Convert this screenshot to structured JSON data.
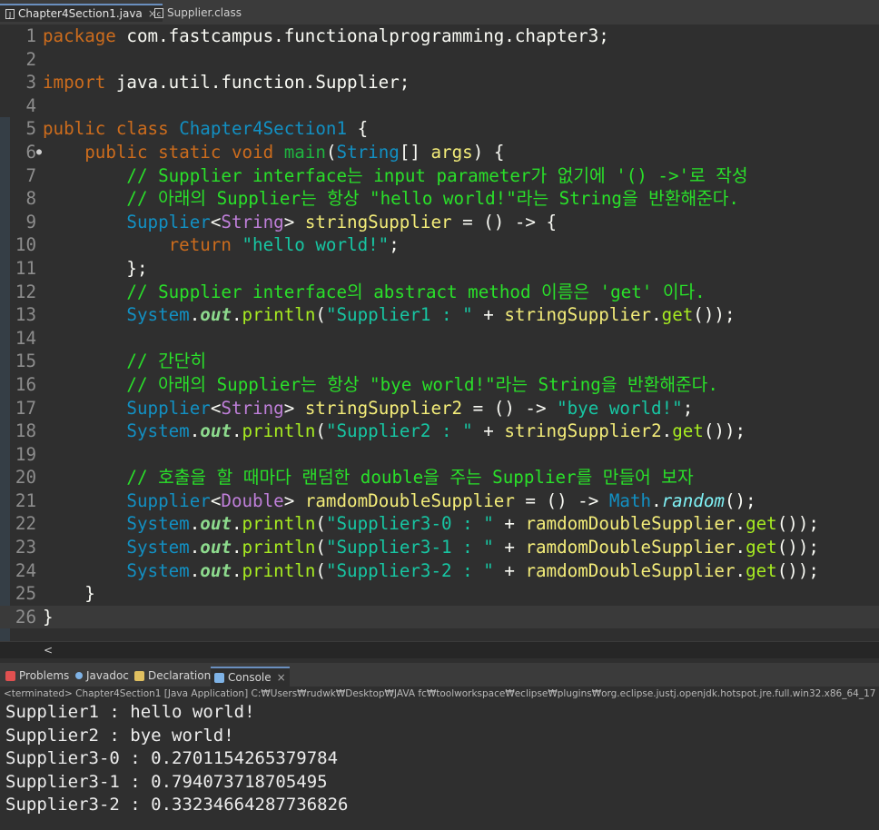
{
  "editor_tabs": [
    {
      "label": "Chapter4Section1.java",
      "close": "×",
      "active": true
    },
    {
      "label": "Supplier.class",
      "active": false
    }
  ],
  "code_lines": [
    {
      "n": "1",
      "tokens": [
        [
          "k",
          "package"
        ],
        [
          "p",
          " com.fastcampus.functionalprogramming.chapter3;"
        ]
      ]
    },
    {
      "n": "2",
      "tokens": []
    },
    {
      "n": "3",
      "tokens": [
        [
          "k",
          "import"
        ],
        [
          "p",
          " java.util.function.Supplier;"
        ]
      ]
    },
    {
      "n": "4",
      "tokens": []
    },
    {
      "n": "5",
      "tokens": [
        [
          "k",
          "public"
        ],
        [
          "p",
          " "
        ],
        [
          "k",
          "class"
        ],
        [
          "p",
          " "
        ],
        [
          "t",
          "Chapter4Section1"
        ],
        [
          "p",
          " {"
        ]
      ]
    },
    {
      "n": "6",
      "overrideMarker": "●",
      "tokens": [
        [
          "p",
          "    "
        ],
        [
          "k",
          "public"
        ],
        [
          "p",
          " "
        ],
        [
          "k",
          "static"
        ],
        [
          "p",
          " "
        ],
        [
          "k",
          "void"
        ],
        [
          "p",
          " "
        ],
        [
          "m",
          "main"
        ],
        [
          "p",
          "("
        ],
        [
          "t",
          "String"
        ],
        [
          "p",
          "[] "
        ],
        [
          "v",
          "args"
        ],
        [
          "p",
          ") {"
        ]
      ]
    },
    {
      "n": "7",
      "tokens": [
        [
          "p",
          "        "
        ],
        [
          "c",
          "// Supplier interface는 input parameter가 없기에 '() ->'로 작성"
        ]
      ]
    },
    {
      "n": "8",
      "tokens": [
        [
          "p",
          "        "
        ],
        [
          "c",
          "// 아래의 Supplier는 항상 \"hello world!\"라는 String을 반환해준다."
        ]
      ]
    },
    {
      "n": "9",
      "tokens": [
        [
          "p",
          "        "
        ],
        [
          "t",
          "Supplier"
        ],
        [
          "p",
          "<"
        ],
        [
          "tp",
          "String"
        ],
        [
          "p",
          "> "
        ],
        [
          "v",
          "stringSupplier"
        ],
        [
          "p",
          " = () -> {"
        ]
      ]
    },
    {
      "n": "10",
      "tokens": [
        [
          "p",
          "            "
        ],
        [
          "k",
          "return"
        ],
        [
          "p",
          " "
        ],
        [
          "s",
          "\"hello world!\""
        ],
        [
          "p",
          ";"
        ]
      ]
    },
    {
      "n": "11",
      "tokens": [
        [
          "p",
          "        };"
        ]
      ]
    },
    {
      "n": "12",
      "tokens": [
        [
          "p",
          "        "
        ],
        [
          "c",
          "// Supplier interface의 abstract method 이름은 'get' 이다."
        ]
      ]
    },
    {
      "n": "13",
      "tokens": [
        [
          "p",
          "        "
        ],
        [
          "t",
          "System"
        ],
        [
          "p",
          "."
        ],
        [
          "f",
          "out"
        ],
        [
          "p",
          "."
        ],
        [
          "g",
          "println"
        ],
        [
          "p",
          "("
        ],
        [
          "s",
          "\"Supplier1 : \""
        ],
        [
          "p",
          " + "
        ],
        [
          "v",
          "stringSupplier"
        ],
        [
          "p",
          "."
        ],
        [
          "g",
          "get"
        ],
        [
          "p",
          "());"
        ]
      ]
    },
    {
      "n": "14",
      "tokens": []
    },
    {
      "n": "15",
      "tokens": [
        [
          "p",
          "        "
        ],
        [
          "c",
          "// 간단히"
        ]
      ]
    },
    {
      "n": "16",
      "tokens": [
        [
          "p",
          "        "
        ],
        [
          "c",
          "// 아래의 Supplier는 항상 \"bye world!\"라는 String을 반환해준다."
        ]
      ]
    },
    {
      "n": "17",
      "tokens": [
        [
          "p",
          "        "
        ],
        [
          "t",
          "Supplier"
        ],
        [
          "p",
          "<"
        ],
        [
          "tp",
          "String"
        ],
        [
          "p",
          "> "
        ],
        [
          "v",
          "stringSupplier2"
        ],
        [
          "p",
          " = () -> "
        ],
        [
          "s",
          "\"bye world!\""
        ],
        [
          "p",
          ";"
        ]
      ]
    },
    {
      "n": "18",
      "tokens": [
        [
          "p",
          "        "
        ],
        [
          "t",
          "System"
        ],
        [
          "p",
          "."
        ],
        [
          "f",
          "out"
        ],
        [
          "p",
          "."
        ],
        [
          "g",
          "println"
        ],
        [
          "p",
          "("
        ],
        [
          "s",
          "\"Supplier2 : \""
        ],
        [
          "p",
          " + "
        ],
        [
          "v",
          "stringSupplier2"
        ],
        [
          "p",
          "."
        ],
        [
          "g",
          "get"
        ],
        [
          "p",
          "());"
        ]
      ]
    },
    {
      "n": "19",
      "tokens": []
    },
    {
      "n": "20",
      "tokens": [
        [
          "p",
          "        "
        ],
        [
          "c",
          "// 호출을 할 때마다 랜덤한 double을 주는 Supplier를 만들어 보자"
        ]
      ]
    },
    {
      "n": "21",
      "tokens": [
        [
          "p",
          "        "
        ],
        [
          "t",
          "Supplier"
        ],
        [
          "p",
          "<"
        ],
        [
          "tp",
          "Double"
        ],
        [
          "p",
          "> "
        ],
        [
          "v",
          "ramdomDoubleSupplier"
        ],
        [
          "p",
          " = () -> "
        ],
        [
          "t",
          "Math"
        ],
        [
          "p",
          "."
        ],
        [
          "it",
          "random"
        ],
        [
          "p",
          "();"
        ]
      ]
    },
    {
      "n": "22",
      "tokens": [
        [
          "p",
          "        "
        ],
        [
          "t",
          "System"
        ],
        [
          "p",
          "."
        ],
        [
          "f",
          "out"
        ],
        [
          "p",
          "."
        ],
        [
          "g",
          "println"
        ],
        [
          "p",
          "("
        ],
        [
          "s",
          "\"Supplier3-0 : \""
        ],
        [
          "p",
          " + "
        ],
        [
          "v",
          "ramdomDoubleSupplier"
        ],
        [
          "p",
          "."
        ],
        [
          "g",
          "get"
        ],
        [
          "p",
          "());"
        ]
      ]
    },
    {
      "n": "23",
      "tokens": [
        [
          "p",
          "        "
        ],
        [
          "t",
          "System"
        ],
        [
          "p",
          "."
        ],
        [
          "f",
          "out"
        ],
        [
          "p",
          "."
        ],
        [
          "g",
          "println"
        ],
        [
          "p",
          "("
        ],
        [
          "s",
          "\"Supplier3-1 : \""
        ],
        [
          "p",
          " + "
        ],
        [
          "v",
          "ramdomDoubleSupplier"
        ],
        [
          "p",
          "."
        ],
        [
          "g",
          "get"
        ],
        [
          "p",
          "());"
        ]
      ]
    },
    {
      "n": "24",
      "tokens": [
        [
          "p",
          "        "
        ],
        [
          "t",
          "System"
        ],
        [
          "p",
          "."
        ],
        [
          "f",
          "out"
        ],
        [
          "p",
          "."
        ],
        [
          "g",
          "println"
        ],
        [
          "p",
          "("
        ],
        [
          "s",
          "\"Supplier3-2 : \""
        ],
        [
          "p",
          " + "
        ],
        [
          "v",
          "ramdomDoubleSupplier"
        ],
        [
          "p",
          "."
        ],
        [
          "g",
          "get"
        ],
        [
          "p",
          "());"
        ]
      ]
    },
    {
      "n": "25",
      "tokens": [
        [
          "p",
          "    }"
        ]
      ]
    },
    {
      "n": "26",
      "current": true,
      "tokens": [
        [
          "p",
          "}"
        ]
      ]
    }
  ],
  "hscroll_arrow": "<",
  "panel_tabs": [
    {
      "label": "Problems",
      "icon": "problems-icon",
      "color": "#e05050"
    },
    {
      "label": "Javadoc",
      "icon": "javadoc-icon",
      "color": "#7fb3e6"
    },
    {
      "label": "Declaration",
      "icon": "declaration-icon",
      "color": "#e0c060"
    },
    {
      "label": "Console",
      "icon": "console-icon",
      "color": "#7fb3e6",
      "active": true,
      "close": "×"
    }
  ],
  "console_status": "<terminated> Chapter4Section1 [Java Application] C:₩Users₩rudwk₩Desktop₩JAVA fc₩toolworkspace₩eclipse₩plugins₩org.eclipse.justj.openjdk.hotspot.jre.full.win32.x86_64_17",
  "console_output": [
    "Supplier1 : hello world!",
    "Supplier2 : bye world!",
    "Supplier3-0 : 0.2701154265379784",
    "Supplier3-1 : 0.794073718705495",
    "Supplier3-2 : 0.33234664287736826"
  ],
  "colors": {
    "background": "#2f2f2f",
    "keyword": "#cc6c1d",
    "type": "#1290c3",
    "comment": "#2ae02a",
    "string": "#17c6a3",
    "variable": "#f3ec79"
  }
}
